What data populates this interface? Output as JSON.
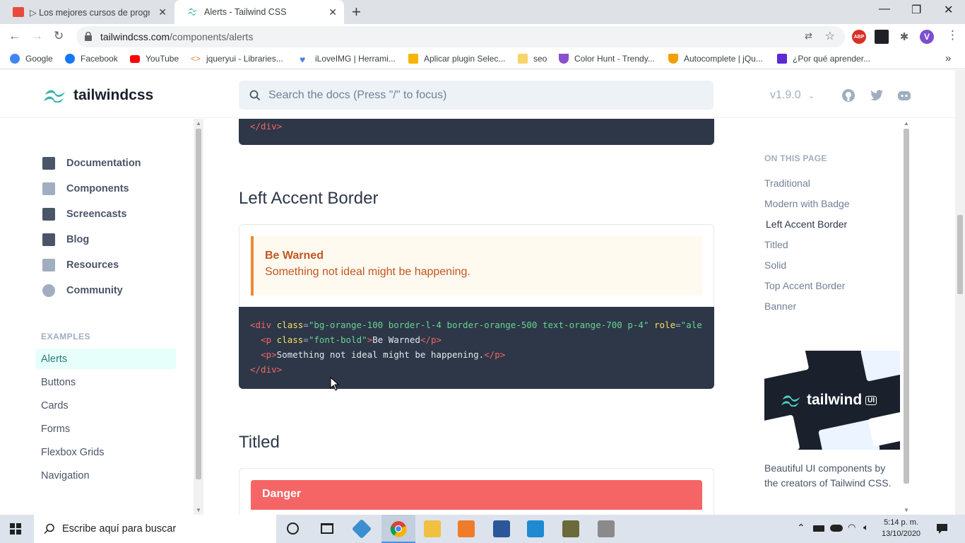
{
  "browser": {
    "tabs": [
      {
        "label": "▷ Los mejores cursos de program"
      },
      {
        "label": "Alerts - Tailwind CSS"
      }
    ],
    "new_tab": "+",
    "window_controls": {
      "minimize": "—",
      "restore": "❐",
      "close": "✕"
    },
    "url_host": "tailwindcss.com",
    "url_path": "/components/alerts",
    "profile_initial": "V",
    "bookmarks": [
      {
        "label": "Google",
        "color": "#4285f4"
      },
      {
        "label": "Facebook",
        "color": "#1877f2"
      },
      {
        "label": "YouTube",
        "color": "#ff0000"
      },
      {
        "label": "jqueryui - Libraries...",
        "color": "#e08a3c"
      },
      {
        "label": "iLoveIMG | Herrami...",
        "color": "#4a7fe0"
      },
      {
        "label": "Aplicar plugin Selec...",
        "color": "#f4b400"
      },
      {
        "label": "seo",
        "color": "#f9d36b"
      },
      {
        "label": "Color Hunt - Trendy...",
        "color": "#8a4fcf"
      },
      {
        "label": "Autocomplete | jQu...",
        "color": "#f29f05"
      },
      {
        "label": "¿Por qué aprender...",
        "color": "#5b2bd6"
      }
    ],
    "more_bookmarks": "»"
  },
  "site": {
    "logo_text": "tailwindcss",
    "search_placeholder": "Search the docs (Press \"/\" to focus)",
    "version": "v1.9.0"
  },
  "sidebar": {
    "nav": [
      {
        "label": "Documentation"
      },
      {
        "label": "Components"
      },
      {
        "label": "Screencasts"
      },
      {
        "label": "Blog"
      },
      {
        "label": "Resources"
      },
      {
        "label": "Community"
      }
    ],
    "examples_heading": "EXAMPLES",
    "examples": [
      {
        "label": "Alerts",
        "active": true
      },
      {
        "label": "Buttons"
      },
      {
        "label": "Cards"
      },
      {
        "label": "Forms"
      },
      {
        "label": "Flexbox Grids"
      },
      {
        "label": "Navigation"
      }
    ]
  },
  "main": {
    "top_code_tail": "</div>",
    "section_left_accent": {
      "title": "Left Accent Border",
      "alert_title": "Be Warned",
      "alert_body": "Something not ideal might be happening.",
      "code": {
        "line1_tag": "div",
        "line1_class_attr": "class",
        "line1_class_val": "bg-orange-100 border-l-4 border-orange-500 text-orange-700 p-4",
        "line1_role_attr": "role",
        "line1_role_val": "ale",
        "line2_tag": "p",
        "line2_class_attr": "class",
        "line2_class_val": "font-bold",
        "line2_text": "Be Warned",
        "line3_tag": "p",
        "line3_text": "Something not ideal might be happening.",
        "line4_close": "</div>"
      }
    },
    "section_titled": {
      "title": "Titled",
      "alert_title": "Danger"
    }
  },
  "on_this_page": {
    "heading": "ON THIS PAGE",
    "items": [
      {
        "label": "Traditional"
      },
      {
        "label": "Modern with Badge"
      },
      {
        "label": "Left Accent Border",
        "current": true
      },
      {
        "label": "Titled"
      },
      {
        "label": "Solid"
      },
      {
        "label": "Top Accent Border"
      },
      {
        "label": "Banner"
      }
    ],
    "ad_logo_text": "tailwind",
    "ad_badge": "UI",
    "ad_text": "Beautiful UI components by the creators of Tailwind CSS."
  },
  "taskbar": {
    "search_placeholder": "Escribe aquí para buscar",
    "time": "5:14 p. m.",
    "date": "13/10/2020"
  },
  "colors": {
    "alert_bg": "#fffaf0",
    "alert_border": "#ed8936",
    "alert_text": "#c05621",
    "danger_bg": "#f56565",
    "code_bg": "#2d3748",
    "active_example_bg": "#e6fffa",
    "brand": "#38b2ac"
  }
}
